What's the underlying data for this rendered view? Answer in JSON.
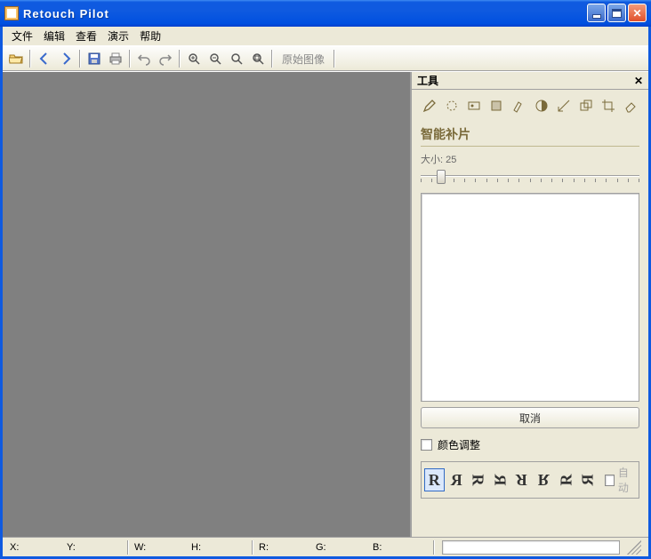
{
  "window": {
    "title": "Retouch Pilot"
  },
  "menu": {
    "items": [
      "文件",
      "编辑",
      "查看",
      "演示",
      "帮助"
    ]
  },
  "toolbar": {
    "original_label": "原始图像"
  },
  "panel": {
    "header": "工具",
    "section_title": "智能补片",
    "size_label": "大小:",
    "size_value": "25",
    "cancel": "取消",
    "color_adjust": "颜色调整",
    "auto": "自动",
    "orient_glyphs": [
      "R",
      "R",
      "R",
      "R",
      "R",
      "R",
      "R",
      "R"
    ]
  },
  "status": {
    "labels": [
      "X:",
      "Y:",
      "W:",
      "H:",
      "R:",
      "G:",
      "B:"
    ]
  }
}
